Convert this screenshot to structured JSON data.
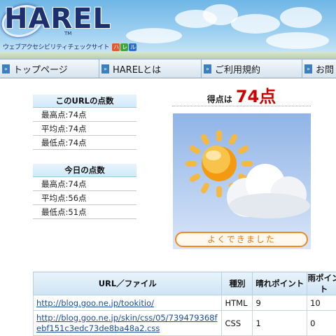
{
  "header": {
    "logo": "HAREL",
    "tagline": "ウェブアクセシビリティチェックサイト",
    "tagline_kana": [
      "ハ",
      "レ",
      "ル"
    ],
    "tm": "TM"
  },
  "nav": {
    "items": [
      {
        "label": "トップページ"
      },
      {
        "label": "HARELとは"
      },
      {
        "label": "ご利用規約"
      },
      {
        "label": "お問"
      }
    ]
  },
  "url_scores": {
    "title": "このURLの点数",
    "rows": [
      "最高点:74点",
      "平均点:74点",
      "最低点:74点"
    ]
  },
  "today_scores": {
    "title": "今日の点数",
    "rows": [
      "最高点:74点",
      "平均点:56点",
      "最低点:51点"
    ]
  },
  "result": {
    "score_label": "得点は",
    "score_value": "74点",
    "badge": "よくできました"
  },
  "table": {
    "headers": [
      "URL／ファイル",
      "種別",
      "晴れポイント",
      "雨ポイント"
    ],
    "rows": [
      {
        "url": "http://blog.goo.ne.jp/tookitio/",
        "type": "HTML",
        "sun": "9",
        "rain": "10"
      },
      {
        "url": "http://blog.goo.ne.jp/skin/css/05/739479368febf151c3edc73de8ba48a2.css",
        "type": "CSS",
        "sun": "1",
        "rain": "0"
      }
    ]
  },
  "colors": {
    "score_red": "#cc0000",
    "badge_orange": "#f08a1c",
    "link_blue": "#1a4c9c"
  },
  "icons": [
    "arrow-right-icon",
    "sun-icon",
    "cloud-icon"
  ]
}
